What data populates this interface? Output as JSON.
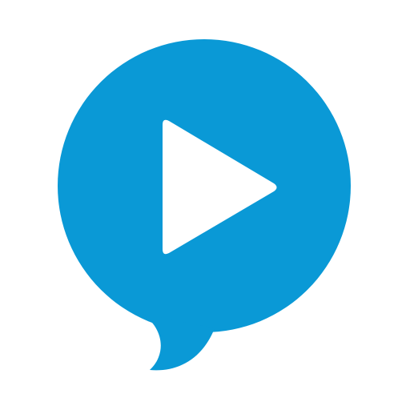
{
  "app_icon": {
    "icon": "speech-bubble-play-icon",
    "colors": {
      "bubble": "#0a99d6",
      "play_symbol": "#ffffff",
      "background": "#ffffff"
    }
  }
}
